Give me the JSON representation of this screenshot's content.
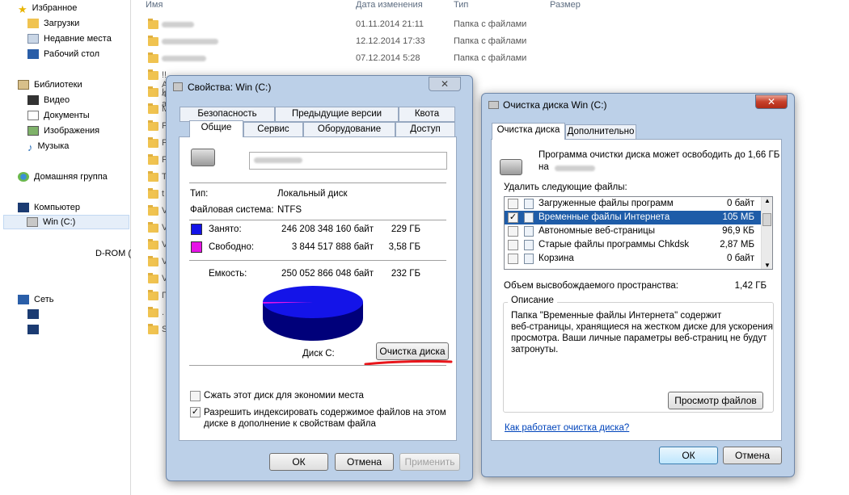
{
  "explorer": {
    "nav": {
      "favorites": "Избранное",
      "downloads": "Загрузки",
      "recent": "Недавние места",
      "desktop": "Рабочий стол",
      "libraries": "Библиотеки",
      "video": "Видео",
      "documents": "Документы",
      "images": "Изображения",
      "music": "Музыка",
      "homegroup": "Домашняя группа",
      "computer": "Компьютер",
      "drive_c": "Win (C:)",
      "cdrom": "D-ROM (",
      "network": "Сеть"
    },
    "headers": {
      "name": "Имя",
      "date": "Дата изменения",
      "type": "Тип",
      "size": "Размер"
    },
    "rows": [
      {
        "date": "01.11.2014 21:11",
        "type": "Папка с файлами"
      },
      {
        "date": "12.12.2014 17:33",
        "type": "Папка с файлами"
      },
      {
        "date": "07.12.2014 5:28",
        "type": "Папка с файлами"
      }
    ],
    "partial_names": [
      "!! All 4 all",
      "I",
      "M",
      "F",
      "F",
      "F",
      "T",
      "t",
      "V",
      "V",
      "V",
      "V",
      "V",
      "П",
      ".",
      "S"
    ]
  },
  "properties": {
    "title": "Свойства: Win (C:)",
    "tabs_row1": [
      "Безопасность",
      "Предыдущие версии",
      "Квота"
    ],
    "tabs_row2": [
      "Общие",
      "Сервис",
      "Оборудование",
      "Доступ"
    ],
    "type_label": "Тип:",
    "type_value": "Локальный диск",
    "fs_label": "Файловая система:",
    "fs_value": "NTFS",
    "used_label": "Занято:",
    "used_bytes": "246 208 348 160 байт",
    "used_gb": "229 ГБ",
    "free_label": "Свободно:",
    "free_bytes": "3 844 517 888 байт",
    "free_gb": "3,58 ГБ",
    "capacity_label": "Емкость:",
    "capacity_bytes": "250 052 866 048 байт",
    "capacity_gb": "232 ГБ",
    "disk_label": "Диск C:",
    "cleanup_button": "Очистка диска",
    "compress_label": "Сжать этот диск для экономии места",
    "index_label_1": "Разрешить индексировать содержимое файлов на этом",
    "index_label_2": "диске в дополнение к свойствам файла",
    "ok": "ОК",
    "cancel": "Отмена",
    "apply": "Применить",
    "colors": {
      "used": "#1414e8",
      "free": "#e614e6"
    },
    "chart_used_fraction": 0.9846
  },
  "cleanup": {
    "title": "Очистка диска Win (C:)",
    "tabs": [
      "Очистка диска",
      "Дополнительно"
    ],
    "intro_1": "Программа очистки диска может освободить до 1,66 ГБ",
    "intro_2": "на",
    "delete_label": "Удалить следующие файлы:",
    "items": [
      {
        "name": "Загруженные файлы программ",
        "size": "0 байт",
        "checked": false
      },
      {
        "name": "Временные файлы Интернета",
        "size": "105 МБ",
        "checked": true
      },
      {
        "name": "Автономные веб-страницы",
        "size": "96,9 КБ",
        "checked": false
      },
      {
        "name": "Старые файлы программы Chkdsk",
        "size": "2,87 МБ",
        "checked": false
      },
      {
        "name": "Корзина",
        "size": "0 байт",
        "checked": false
      }
    ],
    "space_label": "Объем высвобождаемого пространства:",
    "space_value": "1,42 ГБ",
    "description_label": "Описание",
    "description_1": "Папка \"Временные файлы Интернета\" содержит",
    "description_2": "веб-страницы, хранящиеся на жестком диске для ускорения",
    "description_3": "просмотра. Ваши личные параметры веб-страниц не будут",
    "description_4": "затронуты.",
    "view_files": "Просмотр файлов",
    "how_link": "Как работает очистка диска?",
    "ok": "ОК",
    "cancel": "Отмена"
  }
}
